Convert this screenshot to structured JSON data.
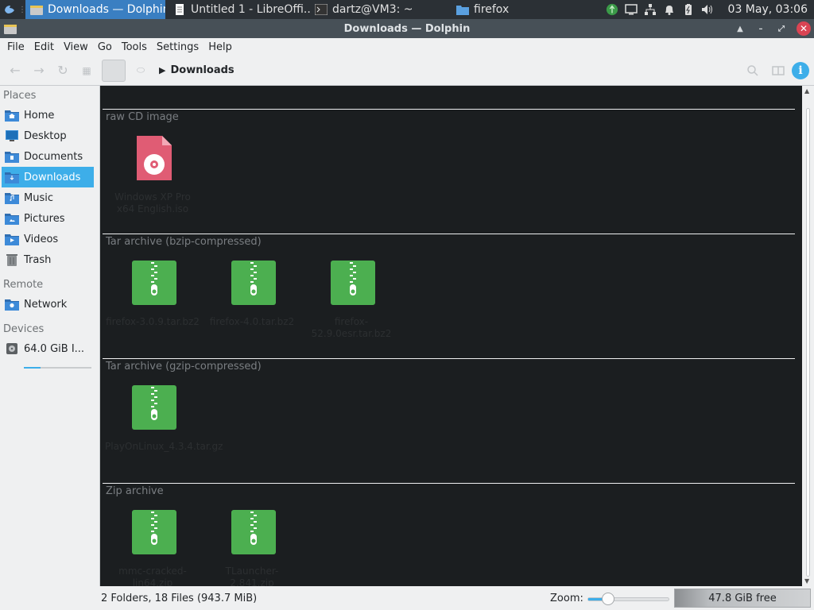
{
  "taskbar": {
    "tasks": [
      {
        "label": "Downloads — Dolphin",
        "icon": "dolphin-icon"
      },
      {
        "label": "Untitled 1 - LibreOffi...",
        "icon": "document-icon"
      },
      {
        "label": "dartz@VM3: ~",
        "icon": "terminal-icon"
      },
      {
        "label": "firefox",
        "icon": "folder-icon"
      }
    ],
    "clock": "03 May, 03:06",
    "tray_icons": [
      "app-green-icon",
      "display-icon",
      "network-icon",
      "bell-icon",
      "battery-icon",
      "volume-icon"
    ]
  },
  "window": {
    "title": "Downloads — Dolphin",
    "buttons": [
      "keep-above",
      "minimize",
      "maximize",
      "close"
    ]
  },
  "menubar": [
    "File",
    "Edit",
    "View",
    "Go",
    "Tools",
    "Settings",
    "Help"
  ],
  "toolbar": {
    "breadcrumb": "Downloads",
    "icons": [
      "back-icon",
      "forward-icon",
      "reload-icon",
      "view-mode-icon",
      "preview-icon"
    ],
    "right_icons": [
      "search-icon",
      "split-icon",
      "info-icon"
    ]
  },
  "sidebar": {
    "sections": {
      "places": "Places",
      "remote": "Remote",
      "devices": "Devices"
    },
    "places": [
      {
        "label": "Home",
        "icon": "home-folder-icon"
      },
      {
        "label": "Desktop",
        "icon": "desktop-icon"
      },
      {
        "label": "Documents",
        "icon": "documents-folder-icon"
      },
      {
        "label": "Downloads",
        "icon": "downloads-folder-icon",
        "selected": true
      },
      {
        "label": "Music",
        "icon": "music-folder-icon"
      },
      {
        "label": "Pictures",
        "icon": "pictures-folder-icon"
      },
      {
        "label": "Videos",
        "icon": "videos-folder-icon"
      },
      {
        "label": "Trash",
        "icon": "trash-icon"
      }
    ],
    "remote": [
      {
        "label": "Network",
        "icon": "network-folder-icon"
      }
    ],
    "devices": [
      {
        "label": "64.0 GiB I...",
        "icon": "drive-icon",
        "used_fraction": 0.25
      }
    ]
  },
  "groups": [
    {
      "title": "raw CD image",
      "files": [
        {
          "name": "Windows XP Pro x64 English.iso",
          "icon": "disc-image-icon"
        }
      ]
    },
    {
      "title": "Tar archive (bzip-compressed)",
      "files": [
        {
          "name": "firefox-3.0.9.tar.bz2",
          "icon": "archive-icon"
        },
        {
          "name": "firefox-4.0.tar.bz2",
          "icon": "archive-icon"
        },
        {
          "name": "firefox-52.9.0esr.tar.bz2",
          "icon": "archive-icon"
        }
      ]
    },
    {
      "title": "Tar archive (gzip-compressed)",
      "files": [
        {
          "name": "PlayOnLinux_4.3.4.tar.gz",
          "icon": "archive-icon"
        }
      ]
    },
    {
      "title": "Zip archive",
      "files": [
        {
          "name": "mmc-cracked-lin64.zip",
          "icon": "archive-icon"
        },
        {
          "name": "TLauncher-2.841.zip",
          "icon": "archive-icon"
        }
      ]
    }
  ],
  "statusbar": {
    "summary": "2 Folders, 18 Files (943.7 MiB)",
    "zoom_label": "Zoom:",
    "zoom_fraction": 0.25,
    "free_space": "47.8 GiB free",
    "used_fraction": 0.25
  },
  "colors": {
    "accent": "#3daee9",
    "view_background": "#1b1e20",
    "archive_green": "#4caf50",
    "disc_pink": "#e05c74",
    "close_red": "#da4453"
  }
}
